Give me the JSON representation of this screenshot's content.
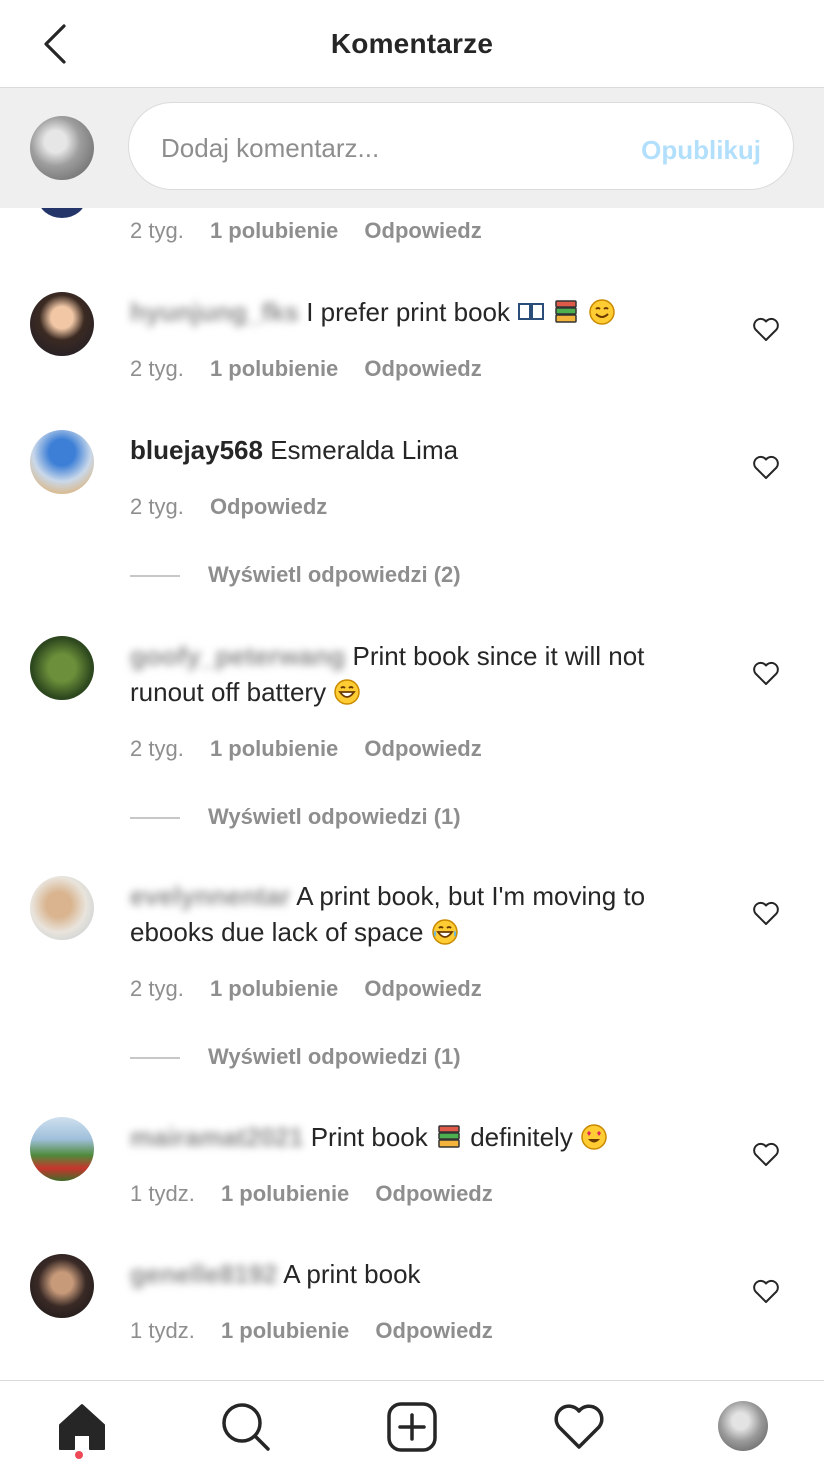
{
  "header": {
    "title": "Komentarze",
    "back_icon": "chevron-left-icon"
  },
  "composer": {
    "placeholder": "Dodaj komentarz...",
    "publish_label": "Opublikuj",
    "publish_color": "#b2dffc"
  },
  "top_partial": {
    "time": "2 tyg.",
    "likes": "1 polubienie",
    "reply": "Odpowiedz"
  },
  "comments": [
    {
      "username": "hyunjung_fks",
      "text": " I prefer print book ",
      "time": "2 tyg.",
      "likes": "1 polubienie",
      "reply": "Odpowiedz",
      "emojis": [
        "open-book-emoji",
        "books-emoji",
        "smiling-face-emoji"
      ]
    },
    {
      "username": "bluejay568",
      "text": " Esmeralda Lima",
      "time": "2 tyg.",
      "reply": "Odpowiedz",
      "view_replies": "Wyświetl odpowiedzi (2)"
    },
    {
      "username": "goofy_peterwang",
      "text": " Print book since it will not runout off battery ",
      "time": "2 tyg.",
      "likes": "1 polubienie",
      "reply": "Odpowiedz",
      "view_replies": "Wyświetl odpowiedzi (1)",
      "emojis": [
        "grinning-face-emoji"
      ]
    },
    {
      "username": "evelynnentar",
      "text": " A print book, but I'm moving to ebooks due lack of space ",
      "time": "2 tyg.",
      "likes": "1 polubienie",
      "reply": "Odpowiedz",
      "view_replies": "Wyświetl odpowiedzi (1)",
      "emojis": [
        "tears-of-joy-emoji"
      ]
    },
    {
      "username": "mairamat2021",
      "text": " Print book ",
      "text2": " definitely ",
      "time": "1 tydz.",
      "likes": "1 polubienie",
      "reply": "Odpowiedz",
      "emojis": [
        "books-emoji",
        "heart-eyes-emoji"
      ]
    },
    {
      "username": "genelle8192",
      "text": " A print book",
      "time": "1 tydz.",
      "likes": "1 polubienie",
      "reply": "Odpowiedz"
    }
  ],
  "nav": {
    "items": [
      "home-icon",
      "search-icon",
      "new-post-icon",
      "activity-heart-icon",
      "profile-avatar"
    ],
    "notification_color": "#ed4956"
  }
}
